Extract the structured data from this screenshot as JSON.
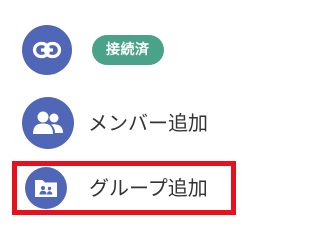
{
  "menu": {
    "link": {
      "icon": "link-icon",
      "status": "接続済",
      "status_color": "#4aa388"
    },
    "add_member": {
      "icon": "people-icon",
      "label": "メンバー追加"
    },
    "add_group": {
      "icon": "group-folder-icon",
      "label": "グループ追加",
      "highlight_color": "#e8101d"
    },
    "avatar_color": "#5067b8"
  }
}
